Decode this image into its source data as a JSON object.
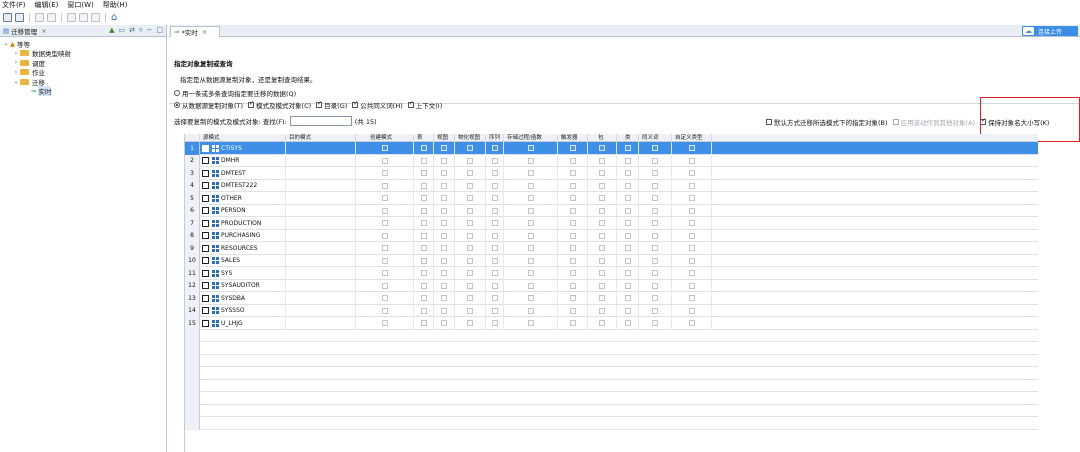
{
  "menubar": [
    "文件(F)",
    "编辑(E)",
    "窗口(W)",
    "帮助(H)"
  ],
  "left_panel": {
    "tab_label": "迁移管理",
    "tree": [
      {
        "label": "等等",
        "level": 0,
        "expanded": true,
        "type": "root"
      },
      {
        "label": "数据类型映射",
        "level": 1,
        "expanded": false,
        "type": "folder"
      },
      {
        "label": "调度",
        "level": 1,
        "expanded": false,
        "type": "folder"
      },
      {
        "label": "作业",
        "level": 1,
        "expanded": false,
        "type": "folder"
      },
      {
        "label": "迁移",
        "level": 1,
        "expanded": true,
        "type": "folder"
      },
      {
        "label": "实时",
        "level": 2,
        "expanded": false,
        "type": "item"
      }
    ]
  },
  "editor": {
    "tab_label": "*实时",
    "share_label": "连接上传",
    "title": "指定对象复制或查询",
    "description": "指定是从数据源复制对象，还是复制查询结果。",
    "radio_query": "用一条或多条查询指定要迁移的数据(Q)",
    "radio_copy": "从数据源复制对象(T)",
    "options": [
      {
        "label": "模式及模式对象(C)",
        "checked": true
      },
      {
        "label": "目录(G)",
        "checked": true
      },
      {
        "label": "公共同义词(H)",
        "checked": true
      },
      {
        "label": "上下文(I)",
        "checked": true
      }
    ],
    "select_label": "选择要复制的模式及模式对象: 查找(F):",
    "search_value": "",
    "count_label": "(共 15)",
    "right_opt1": "默认方式迁移所选模式下的指定对象(B)",
    "right_opt2": "应用该动作到其他对象(A)",
    "right_opt3": "保持对象名大小写(K)"
  },
  "grid": {
    "columns": [
      "源模式",
      "目的模式",
      "创建模式",
      "表",
      "视图",
      "物化视图",
      "序列",
      "存储过程/函数",
      "触发器",
      "包",
      "类",
      "同义词",
      "自定义类型"
    ],
    "rows": [
      {
        "n": "1",
        "name": "CTISYS"
      },
      {
        "n": "2",
        "name": "DMHR"
      },
      {
        "n": "3",
        "name": "DMTEST"
      },
      {
        "n": "4",
        "name": "DMTEST222"
      },
      {
        "n": "5",
        "name": "OTHER"
      },
      {
        "n": "6",
        "name": "PERSON"
      },
      {
        "n": "7",
        "name": "PRODUCTION"
      },
      {
        "n": "8",
        "name": "PURCHASING"
      },
      {
        "n": "9",
        "name": "RESOURCES"
      },
      {
        "n": "10",
        "name": "SALES"
      },
      {
        "n": "11",
        "name": "SYS"
      },
      {
        "n": "12",
        "name": "SYSAUDITOR"
      },
      {
        "n": "13",
        "name": "SYSDBA"
      },
      {
        "n": "14",
        "name": "SYSSSO"
      },
      {
        "n": "15",
        "name": "U_LHJG"
      }
    ]
  },
  "colors": {
    "selection": "#3d8fe8",
    "highlight_box": "#e02020",
    "accent": "#3a8ee6"
  }
}
